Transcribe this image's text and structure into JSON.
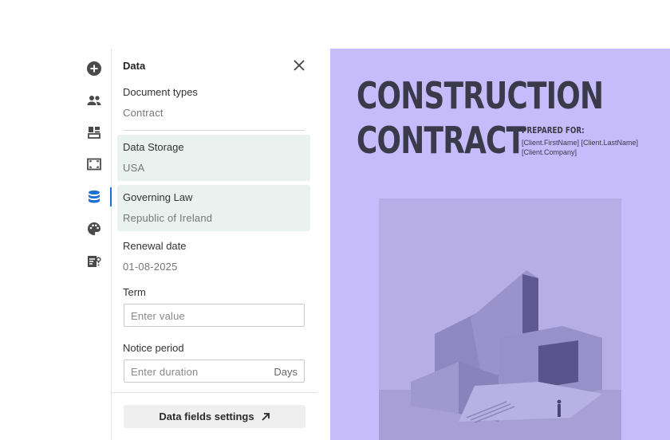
{
  "panel": {
    "title": "Data",
    "fields": [
      {
        "label": "Document types",
        "value": "Contract"
      },
      {
        "label": "Data Storage",
        "value": "USA"
      },
      {
        "label": "Governing Law",
        "value": "Republic of Ireland"
      },
      {
        "label": "Renewal date",
        "value": "01-08-2025"
      }
    ],
    "term": {
      "label": "Term",
      "placeholder": "Enter value"
    },
    "notice": {
      "label": "Notice period",
      "placeholder": "Enter duration",
      "suffix": "Days"
    },
    "settings_button": "Data fields settings"
  },
  "rail": {
    "icons": [
      "add-icon",
      "people-icon",
      "layout-icon",
      "frame-icon",
      "database-icon",
      "palette-icon",
      "data-fields-icon"
    ],
    "active": "database-icon",
    "accent": "#1f6fd1"
  },
  "document": {
    "title_line1": "CONSTRUCTION",
    "title_line2": "CONTRACT",
    "prepared_label": "PREPARED FOR:",
    "prepared_line1": "[Client.FirstName] [Client.LastName]",
    "prepared_line2": "[Client.Company]",
    "background": "#c6bbfb"
  }
}
